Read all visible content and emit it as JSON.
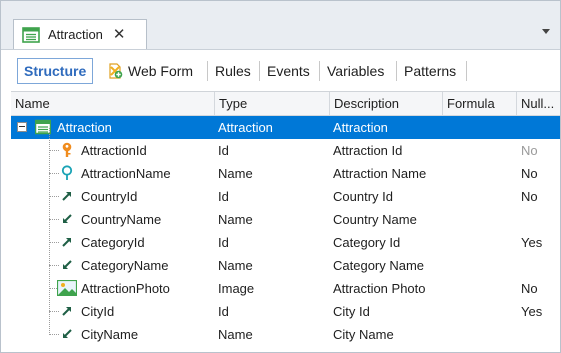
{
  "window": {
    "tab_title": "Attraction",
    "close_glyph": "✕"
  },
  "part_tabs": [
    {
      "label": "Structure",
      "active": true
    },
    {
      "label": "Web Form",
      "icon": "web-form-icon"
    },
    {
      "label": "Rules"
    },
    {
      "label": "Events"
    },
    {
      "label": "Variables"
    },
    {
      "label": "Patterns"
    }
  ],
  "columns": [
    "Name",
    "Type",
    "Description",
    "Formula",
    "Null..."
  ],
  "root": {
    "name": "Attraction",
    "type": "Attraction",
    "description": "Attraction",
    "icon": "transaction-icon"
  },
  "rows": [
    {
      "name": "AttractionId",
      "type": "Id",
      "description": "Attraction Id",
      "nullable": "No",
      "icon": "primary-key-icon"
    },
    {
      "name": "AttractionName",
      "type": "Name",
      "description": "Attraction Name",
      "nullable": "No",
      "icon": "descriptor-icon"
    },
    {
      "name": "CountryId",
      "type": "Id",
      "description": "Country Id",
      "nullable": "No",
      "icon": "foreign-key-icon"
    },
    {
      "name": "CountryName",
      "type": "Name",
      "description": "Country Name",
      "nullable": "",
      "icon": "inferred-icon"
    },
    {
      "name": "CategoryId",
      "type": "Id",
      "description": "Category Id",
      "nullable": "Yes",
      "icon": "foreign-key-icon"
    },
    {
      "name": "CategoryName",
      "type": "Name",
      "description": "Category Name",
      "nullable": "",
      "icon": "inferred-icon"
    },
    {
      "name": "AttractionPhoto",
      "type": "Image",
      "description": "Attraction Photo",
      "nullable": "No",
      "icon": "image-icon"
    },
    {
      "name": "CityId",
      "type": "Id",
      "description": "City Id",
      "nullable": "Yes",
      "icon": "foreign-key-icon"
    },
    {
      "name": "CityName",
      "type": "Name",
      "description": "City Name",
      "nullable": "",
      "icon": "inferred-icon"
    }
  ],
  "colors": {
    "selection": "#0078d7",
    "active_tab_text": "#2f6bbd",
    "key_orange": "#f08c1e",
    "descriptor_teal": "#1aa3b5",
    "link_green": "#1f8a5a",
    "grid_green": "#3fa34d"
  }
}
